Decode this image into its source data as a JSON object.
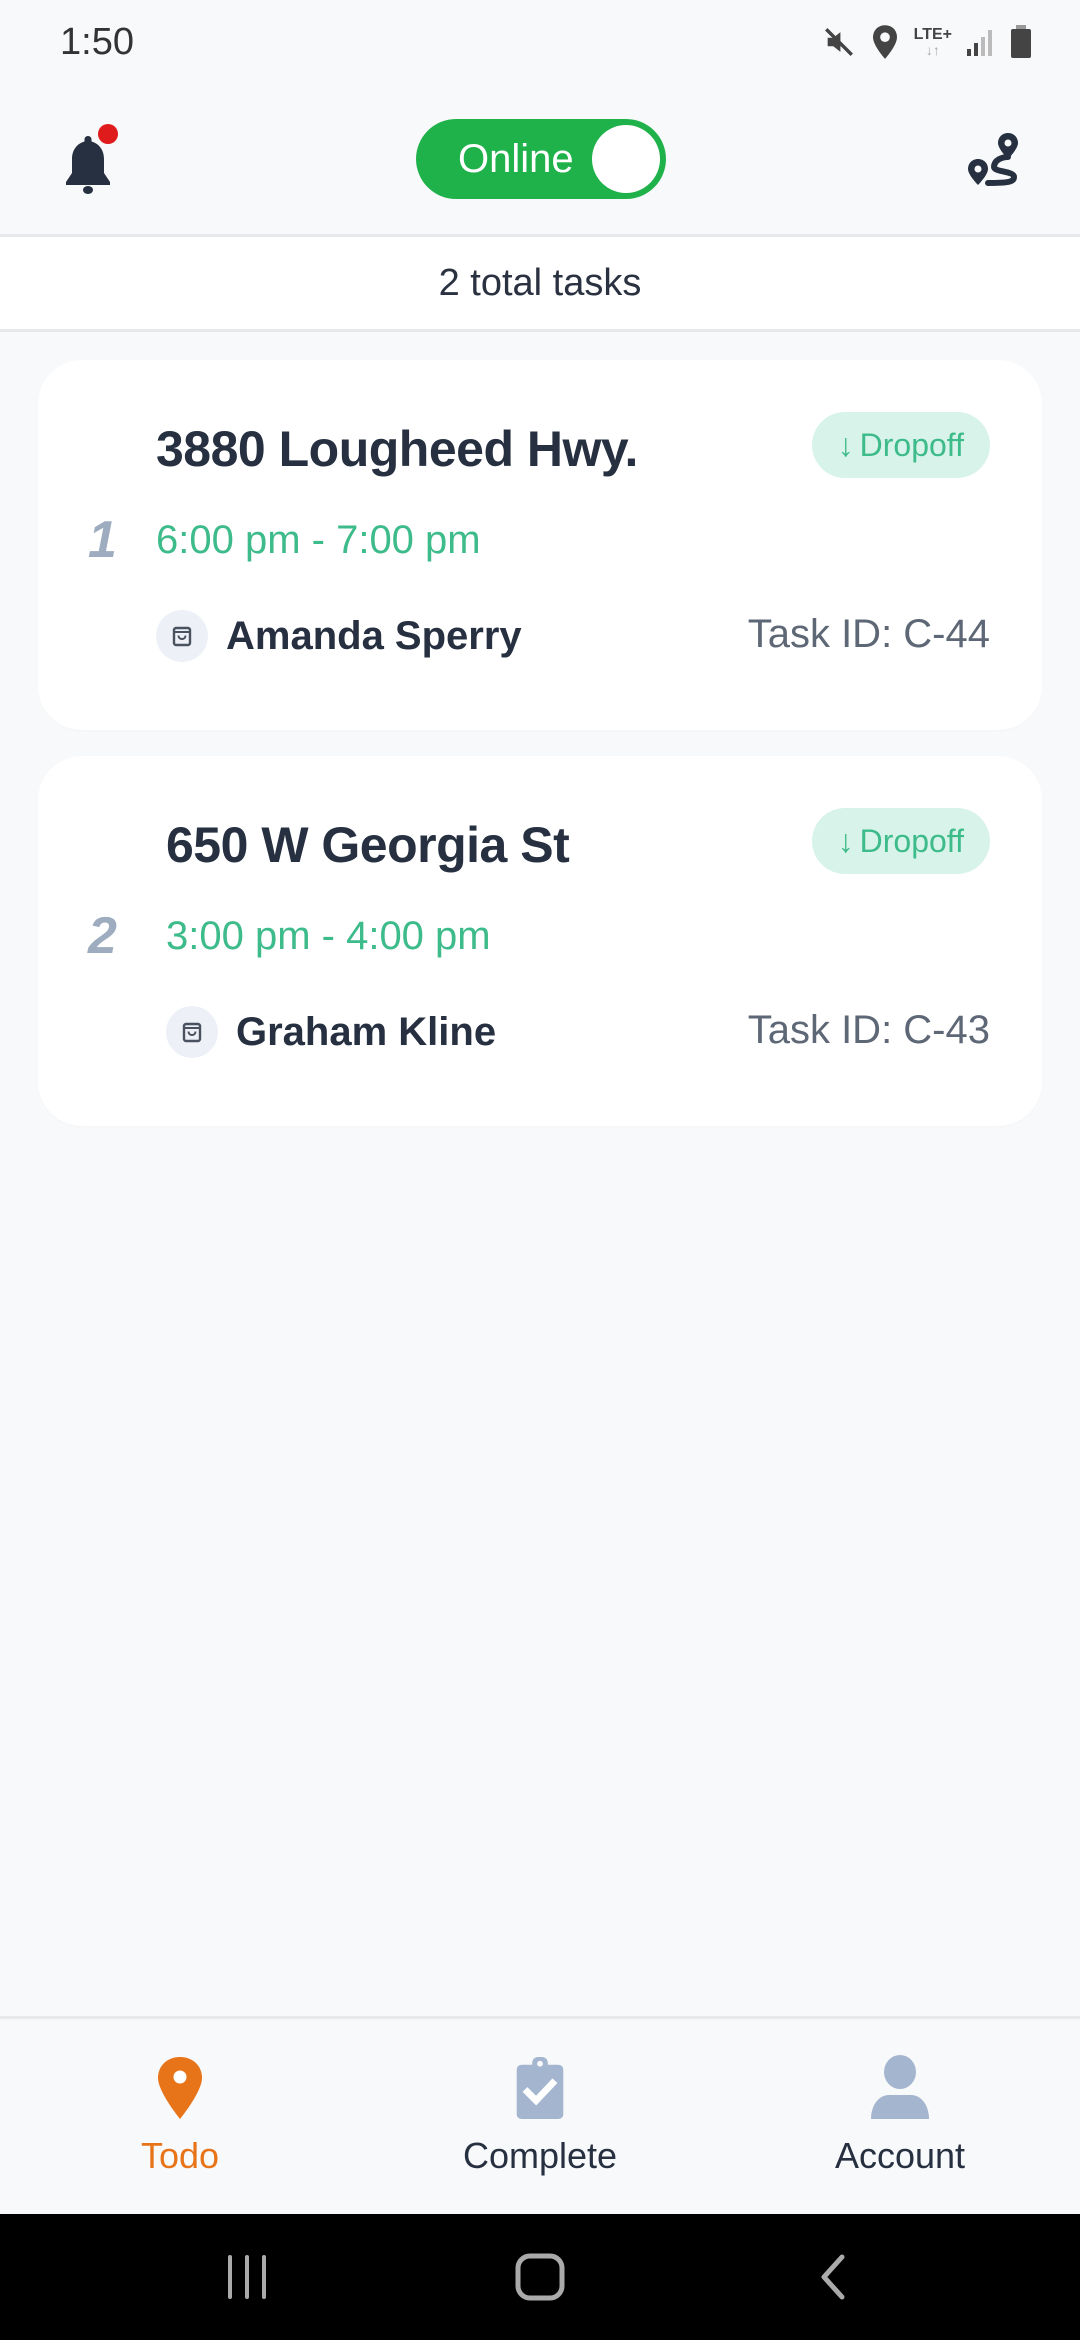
{
  "status_bar": {
    "time": "1:50",
    "network_label": "LTE+",
    "network_arrows": "↓↑",
    "icons": [
      "mute-icon",
      "location-icon",
      "lte-icon",
      "signal-icon",
      "battery-icon"
    ]
  },
  "header": {
    "notifications_icon": "bell-icon",
    "has_unread": true,
    "online_toggle": {
      "label": "Online",
      "on": true
    },
    "route_icon": "route-icon"
  },
  "summary": {
    "text": "2 total tasks"
  },
  "tasks": [
    {
      "index": "1",
      "address": "3880 Lougheed Hwy.",
      "time_window": "6:00 pm - 7:00 pm",
      "badge": {
        "arrow": "↓",
        "label": "Dropoff"
      },
      "customer": "Amanda Sperry",
      "task_id": "Task ID: C-44"
    },
    {
      "index": "2",
      "address": "650 W Georgia St",
      "time_window": "3:00 pm - 4:00 pm",
      "badge": {
        "arrow": "↓",
        "label": "Dropoff"
      },
      "customer": "Graham Kline",
      "task_id": "Task ID: C-43"
    }
  ],
  "bottom_nav": {
    "items": [
      {
        "label": "Todo",
        "icon": "map-pin-icon",
        "active": true
      },
      {
        "label": "Complete",
        "icon": "clipboard-check-icon",
        "active": false
      },
      {
        "label": "Account",
        "icon": "user-icon",
        "active": false
      }
    ]
  },
  "colors": {
    "online_green": "#1fb14a",
    "accent_teal": "#3dbb8a",
    "badge_bg": "#d8f3ea",
    "active_orange": "#e8741a",
    "inactive_icon": "#a3b5cf",
    "notification_red": "#e01b1b"
  }
}
